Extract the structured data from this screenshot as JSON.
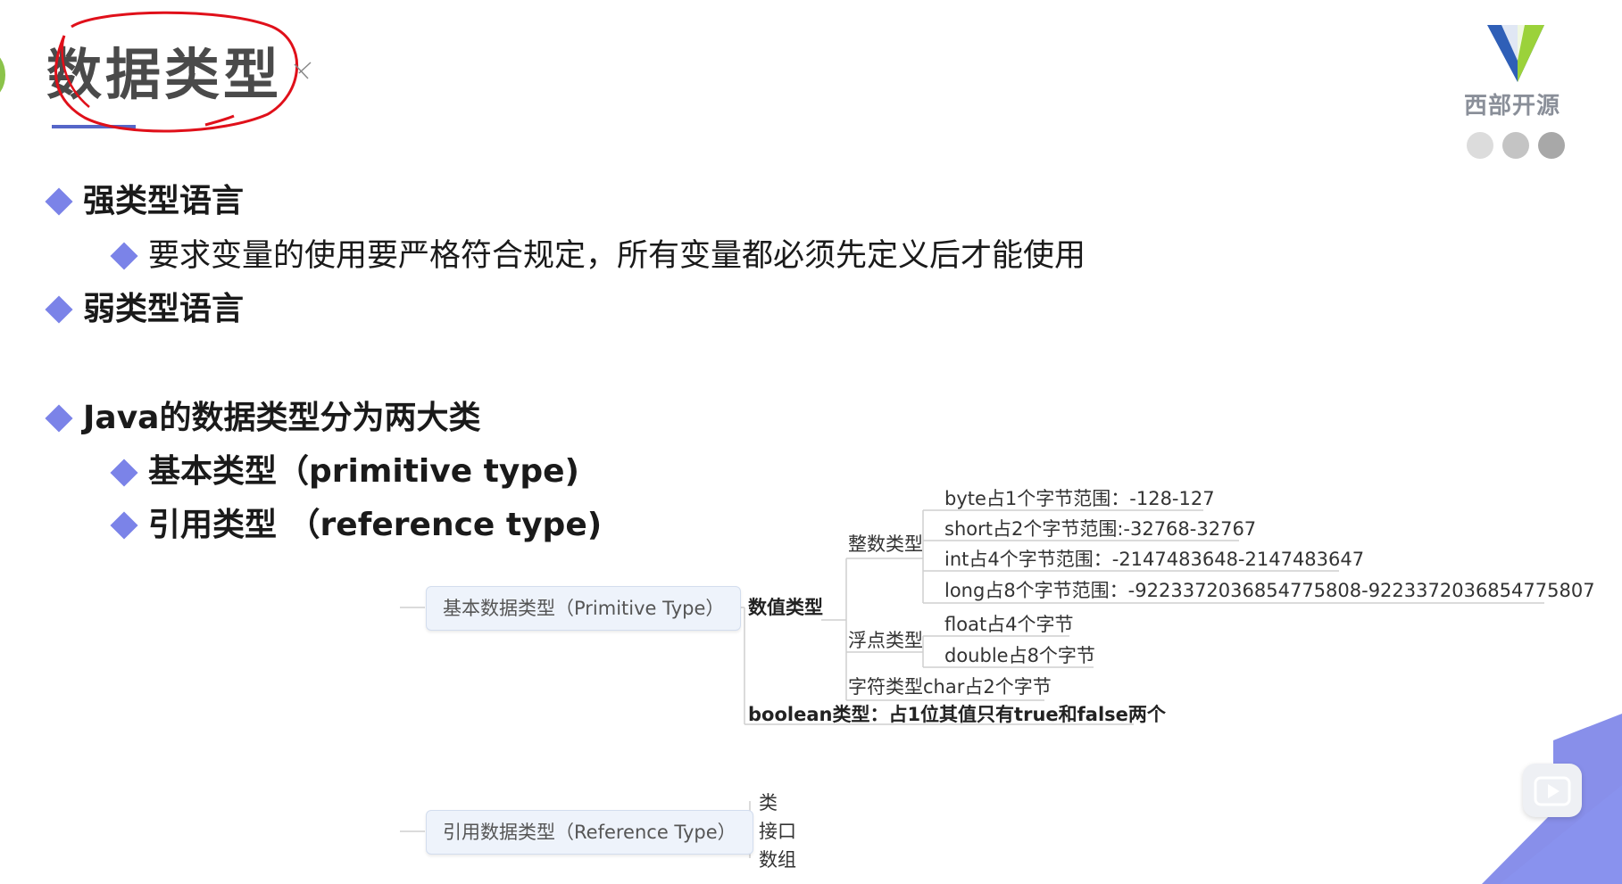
{
  "slide": {
    "title": "数据类型",
    "brand_name": "西部开源",
    "bullets": [
      "强类型语言",
      "要求变量的使用要严格符合规定，所有变量都必须先定义后才能使用",
      "弱类型语言",
      "Java的数据类型分为两大类",
      "基本类型（primitive type)",
      "引用类型 （reference type)"
    ]
  },
  "mindmap": {
    "primitive_root": "基本数据类型（Primitive Type）",
    "numeric": "数值类型",
    "integer": "整数类型",
    "int_items": [
      "byte占1个字节范围：-128-127",
      "short占2个字节范围:-32768-32767",
      "int占4个字节范围：-2147483648-2147483647",
      "long占8个字节范围：-9223372036854775808-9223372036854775807"
    ],
    "float_type": "浮点类型",
    "float_items": [
      "float占4个字节",
      "double占8个字节"
    ],
    "char_type": "字符类型char占2个字节",
    "boolean_type": "boolean类型：占1位其值只有true和false两个",
    "reference_root": "引用数据类型（Reference Type）",
    "reference_items": [
      "类",
      "接口",
      "数组"
    ]
  },
  "colors": {
    "bullet": "#7b83e8",
    "annotation_red": "#e0101a",
    "underline": "#5566c8",
    "logo_blue": "#2f5fb7",
    "logo_green": "#9bd23a",
    "dots": [
      "#dcdcdc",
      "#c4c4c4",
      "#a8a8a8"
    ]
  }
}
